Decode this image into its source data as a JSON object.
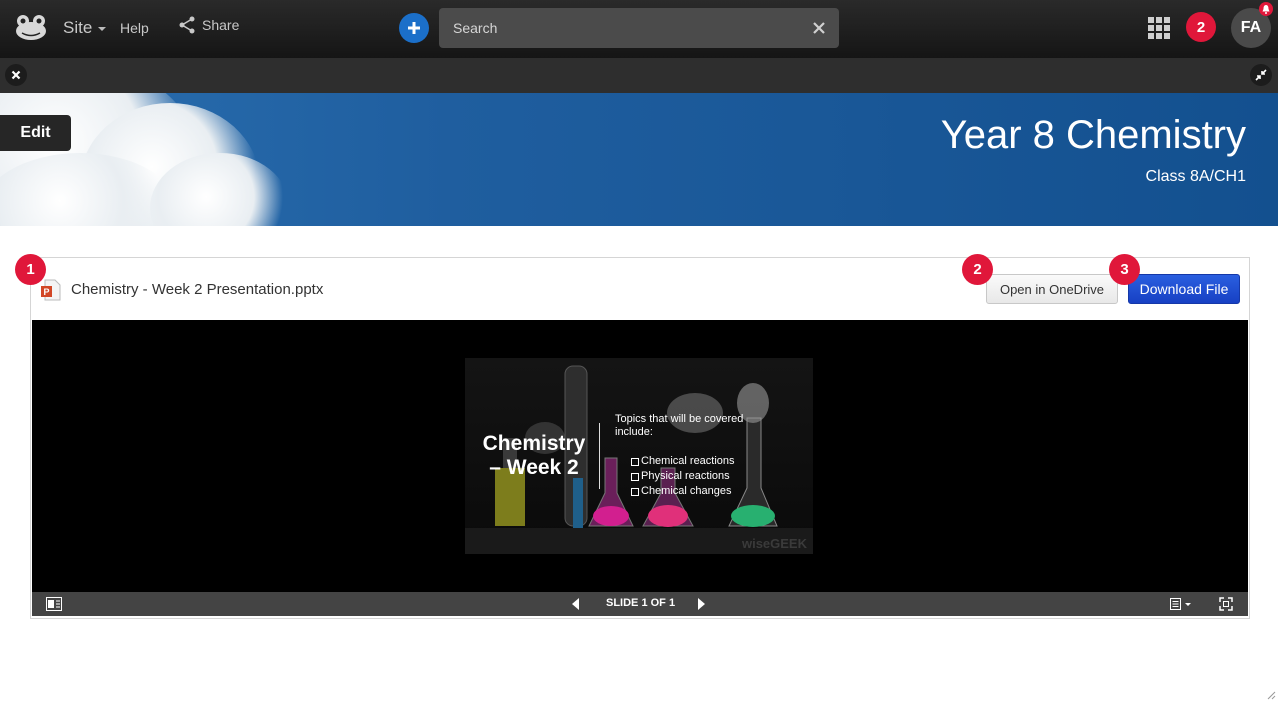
{
  "topbar": {
    "site_label": "Site",
    "help_label": "Help",
    "share_label": "Share",
    "search_placeholder": "Search",
    "notification_count": "2",
    "avatar_initials": "FA"
  },
  "banner": {
    "edit_label": "Edit",
    "title": "Year 8 Chemistry",
    "subtitle": "Class 8A/CH1"
  },
  "file": {
    "name": "Chemistry - Week 2 Presentation.pptx",
    "open_onedrive_label": "Open in OneDrive",
    "download_label": "Download File"
  },
  "slide": {
    "title_line1": "Chemistry",
    "title_line2": "– Week 2",
    "topics_heading": "Topics that will be covered include:",
    "topics": [
      "Chemical reactions",
      "Physical reactions",
      "Chemical changes"
    ],
    "watermark": "wiseGEEK"
  },
  "viewer": {
    "slide_indicator": "SLIDE 1 OF 1"
  },
  "steps": [
    "1",
    "2",
    "3"
  ],
  "colors": {
    "accent_blue": "#1b6fc9",
    "badge_red": "#e0173a",
    "download_blue": "#1f4fd6"
  }
}
